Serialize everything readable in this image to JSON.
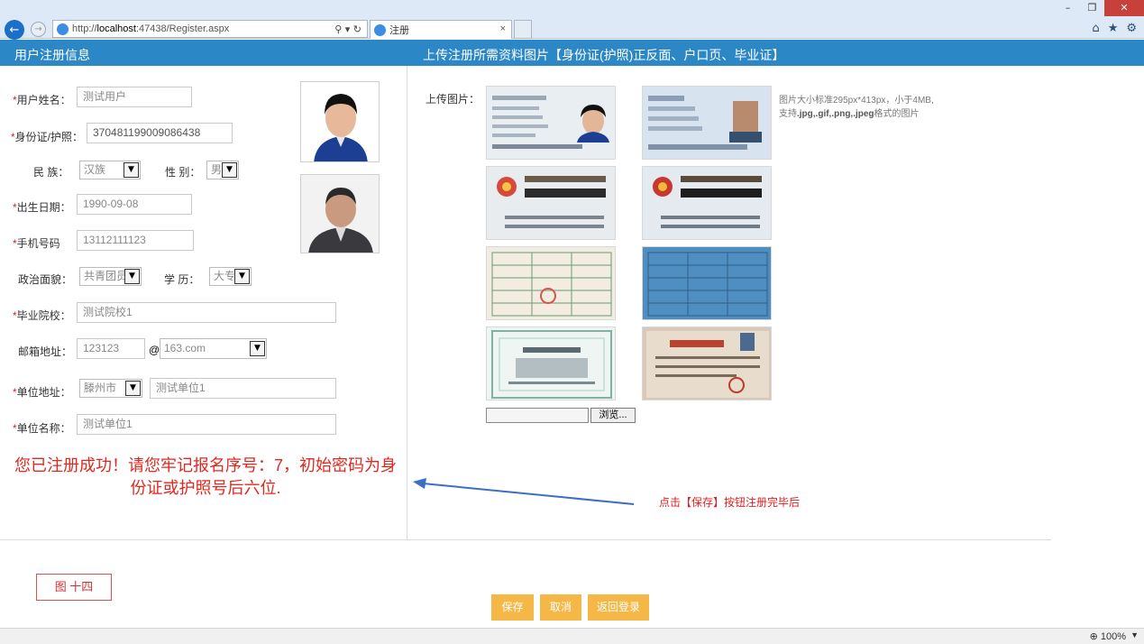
{
  "browser": {
    "url_prefix": "http://",
    "url_host": "localhost",
    "url_rest": ":47438/Register.aspx",
    "address_tools": "⚲ ▾ ↻",
    "tab_title": "注册",
    "tab_close": "×",
    "zoom": "100%"
  },
  "header": {
    "left_title": "用户注册信息",
    "right_title": "上传注册所需资料图片【身份证(护照)正反面、户口页、毕业证】"
  },
  "form": {
    "required_mark": "*",
    "name_label": "用户姓名：",
    "name_value": "测试用户",
    "id_label": "身份证/护照：",
    "id_value": "370481199009086438",
    "ethnic_label": "民 族：",
    "ethnic_value": "汉族",
    "gender_label": "性 别：",
    "gender_value": "男",
    "birth_label": "出生日期：",
    "birth_value": "1990-09-08",
    "phone_label": "手机号码",
    "phone_value": "13112111123",
    "political_label": "政治面貌：",
    "political_value": "共青团员",
    "education_label": "学 历：",
    "education_value": "大专",
    "school_label": "毕业院校：",
    "school_value": "测试院校1",
    "email_label": "邮箱地址：",
    "email_user": "123123",
    "email_at": "@",
    "email_domain": "163.com",
    "work_addr_label": "单位地址：",
    "work_city": "滕州市",
    "work_addr_value": "测试单位1",
    "work_name_label": "单位名称：",
    "work_name_value": "测试单位1"
  },
  "success_message": "您已注册成功！请您牢记报名序号：7，初始密码为身份证或护照号后六位.",
  "upload": {
    "label": "上传图片：",
    "hint_line1": "图片大小标准295px*413px，小于4MB,",
    "hint_line2_pre": "支持",
    "hint_line2_bold": ".jpg,.gif,.png,.jpeg",
    "hint_line2_post": "格式的图片",
    "browse_label": "浏览..."
  },
  "annotation": "点击【保存】按钮注册完毕后",
  "figure_label": "图 十四",
  "buttons": {
    "save": "保存",
    "cancel": "取消",
    "back": "返回登录"
  },
  "colors": {
    "header_blue": "#2c87c7",
    "button_orange": "#f5b746",
    "success_red": "#e1271f"
  }
}
